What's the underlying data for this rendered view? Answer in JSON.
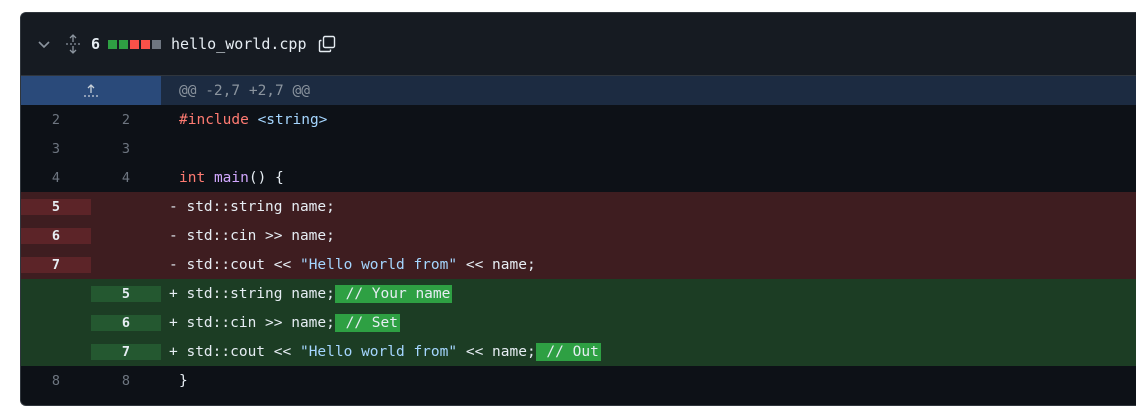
{
  "header": {
    "changes_count": "6",
    "filename": "hello_world.cpp",
    "diffstat_colors": [
      "#2ea043",
      "#2ea043",
      "#f85149",
      "#f85149",
      "#6e7681"
    ]
  },
  "hunk": {
    "header": "@@ -2,7 +2,7 @@"
  },
  "lines": [
    {
      "old": "2",
      "new": "2",
      "sign": " ",
      "segments": [
        {
          "t": "#include",
          "c": "kw"
        },
        {
          "t": " "
        },
        {
          "t": "<string>",
          "c": "str"
        }
      ]
    },
    {
      "old": "3",
      "new": "3",
      "sign": " ",
      "segments": []
    },
    {
      "old": "4",
      "new": "4",
      "sign": " ",
      "segments": [
        {
          "t": "int",
          "c": "kw"
        },
        {
          "t": " "
        },
        {
          "t": "main",
          "c": "fn"
        },
        {
          "t": "() {"
        }
      ]
    },
    {
      "type": "del",
      "old": "5",
      "new": "",
      "sign": "-",
      "segments": [
        {
          "t": "std::string name;"
        }
      ]
    },
    {
      "type": "del",
      "old": "6",
      "new": "",
      "sign": "-",
      "segments": [
        {
          "t": "std::cin >> name;"
        }
      ]
    },
    {
      "type": "del",
      "old": "7",
      "new": "",
      "sign": "-",
      "segments": [
        {
          "t": "std::cout << "
        },
        {
          "t": "\"Hello world from\"",
          "c": "str"
        },
        {
          "t": " << name;"
        }
      ]
    },
    {
      "type": "add",
      "old": "",
      "new": "5",
      "sign": "+",
      "segments": [
        {
          "t": "std::string name;"
        },
        {
          "t": " // Your name",
          "c": "hl"
        }
      ]
    },
    {
      "type": "add",
      "old": "",
      "new": "6",
      "sign": "+",
      "segments": [
        {
          "t": "std::cin >> name;"
        },
        {
          "t": " // Set",
          "c": "hl"
        }
      ]
    },
    {
      "type": "add",
      "old": "",
      "new": "7",
      "sign": "+",
      "segments": [
        {
          "t": "std::cout << "
        },
        {
          "t": "\"Hello world from\"",
          "c": "str"
        },
        {
          "t": " << name;"
        },
        {
          "t": " // Out",
          "c": "hl"
        }
      ]
    },
    {
      "old": "8",
      "new": "8",
      "sign": " ",
      "segments": [
        {
          "t": "}"
        }
      ]
    }
  ],
  "icons": {
    "collapse": "chevron-down-icon",
    "expand_all": "unfold-icon",
    "expand_up": "expand-up-icon",
    "copy": "copy-icon"
  }
}
